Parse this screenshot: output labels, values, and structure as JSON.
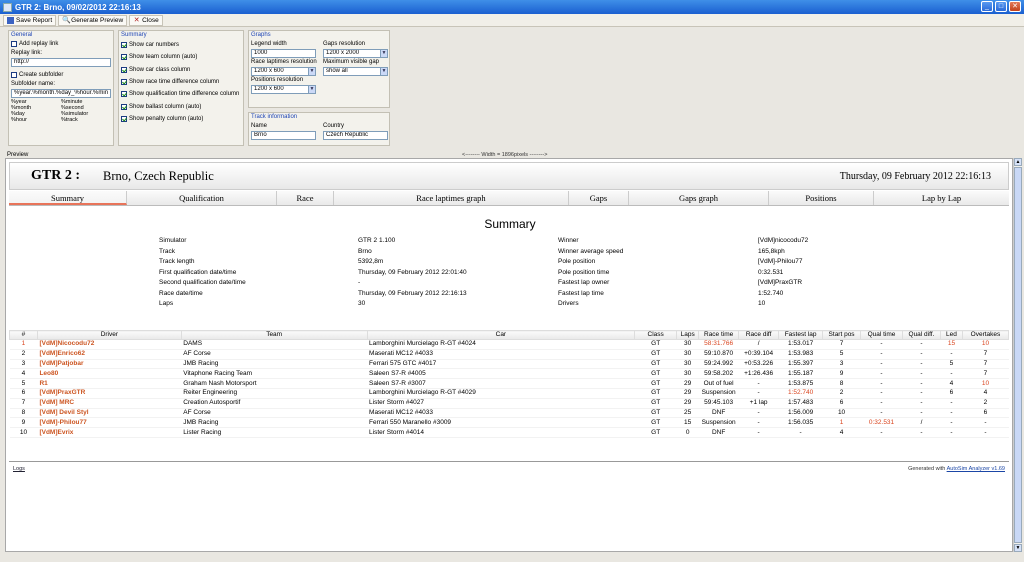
{
  "window": {
    "title": "GTR 2: Brno, 09/02/2012 22:16:13"
  },
  "toolbar": {
    "save_report": "Save Report",
    "generate_preview": "Generate Preview",
    "close": "Close"
  },
  "general": {
    "title": "General",
    "add_replay_link": "Add replay link",
    "replay_link_label": "Replay link:",
    "replay_link_value": "http://",
    "create_subfolder": "Create subfolder",
    "subfolder_name_label": "Subfolder name:",
    "subfolder_name_value": "%year.%month.%day_%hour.%min",
    "vars": [
      "%year",
      "%minute",
      "%month",
      "%second",
      "%day",
      "%simulator",
      "%hour",
      "%track"
    ]
  },
  "summary_opts": {
    "title": "Summary",
    "items": [
      "Show car numbers",
      "Show team column (auto)",
      "Show car class column",
      "Show race time difference column",
      "Show qualification time difference column",
      "Show ballast column (auto)",
      "Show penalty column (auto)"
    ]
  },
  "graphs": {
    "title": "Graphs",
    "legend_width_label": "Legend width",
    "legend_width_value": "1000",
    "gaps_res_label": "Gaps resolution",
    "gaps_res_value": "1200 x 2000",
    "race_lap_res_label": "Race laptimes resolution",
    "race_lap_res_value": "1200 x 600",
    "max_gap_label": "Maximum visible gap",
    "max_gap_value": "show all",
    "positions_res_label": "Positions resolution",
    "positions_res_value": "1200 x 600"
  },
  "track_info": {
    "title": "Track information",
    "name_label": "Name",
    "name_value": "Brno",
    "country_label": "Country",
    "country_value": "Czech Republic"
  },
  "preview_label": "Preview",
  "width_note": "<-------- Width = 1896pixels -------->",
  "report": {
    "header": {
      "sim": "GTR 2 :",
      "track": "Brno, Czech Republic",
      "datetime": "Thursday, 09 February 2012 22:16:13"
    },
    "tabs": [
      "Summary",
      "Qualification",
      "Race",
      "Race laptimes graph",
      "Gaps",
      "Gaps graph",
      "Positions",
      "Lap by Lap"
    ],
    "section_title": "Summary",
    "info_left": [
      [
        "Simulator",
        "GTR 2 1.100"
      ],
      [
        "Track",
        "Brno"
      ],
      [
        "Track length",
        "5392,8m"
      ],
      [
        "First qualification date/time",
        "Thursday, 09 February 2012 22:01:40"
      ],
      [
        "Second qualification date/time",
        "-"
      ],
      [
        "Race date/time",
        "Thursday, 09 February 2012 22:16:13"
      ],
      [
        "Laps",
        "30"
      ]
    ],
    "info_right": [
      [
        "Winner",
        "[VdM]nicocodu72"
      ],
      [
        "Winner average speed",
        "165,8kph"
      ],
      [
        "Pole position",
        "[VdM]-Philou77"
      ],
      [
        "Pole position time",
        "0:32.531"
      ],
      [
        "Fastest lap owner",
        "[VdM]PraxGTR"
      ],
      [
        "Fastest lap time",
        "1:52.740"
      ],
      [
        "Drivers",
        "10"
      ]
    ],
    "columns": [
      "#",
      "Driver",
      "Team",
      "Car",
      "Class",
      "Laps",
      "Race time",
      "Race diff",
      "Fastest lap",
      "Start pos",
      "Qual time",
      "Qual diff.",
      "Led",
      "Overtakes"
    ],
    "rows": [
      [
        "1",
        "[VdM]Nicocodu72",
        "DAMS",
        "Lamborghini Murcielago R-GT #4024",
        "GT",
        "30",
        "58:31.766",
        "/",
        "1:53.017",
        "7",
        "-",
        "-",
        "15",
        "10"
      ],
      [
        "2",
        "[VdM]Enrico62",
        "AF Corse",
        "Maserati MC12 #4033",
        "GT",
        "30",
        "59:10.870",
        "+0:39.104",
        "1:53.983",
        "5",
        "-",
        "-",
        "-",
        "7"
      ],
      [
        "3",
        "[VdM]Patjobar",
        "JMB Racing",
        "Ferrari 575 GTC #4017",
        "GT",
        "30",
        "59:24.992",
        "+0:53.226",
        "1:55.397",
        "3",
        "-",
        "-",
        "5",
        "7"
      ],
      [
        "4",
        "Leo80",
        "Vitaphone Racing Team",
        "Saleen S7-R #4005",
        "GT",
        "30",
        "59:58.202",
        "+1:26.436",
        "1:55.187",
        "9",
        "-",
        "-",
        "-",
        "7"
      ],
      [
        "5",
        "R1",
        "Graham Nash Motorsport",
        "Saleen S7-R #3007",
        "GT",
        "29",
        "Out of fuel",
        "-",
        "1:53.875",
        "8",
        "-",
        "-",
        "4",
        "10"
      ],
      [
        "6",
        "[VdM]PraxGTR",
        "Reiter Engineering",
        "Lamborghini Murcielago R-GT #4029",
        "GT",
        "29",
        "Suspension",
        "-",
        "1:52.740",
        "2",
        "-",
        "-",
        "6",
        "4"
      ],
      [
        "7",
        "[VdM] MRC",
        "Creation Autosportif",
        "Lister Storm #4027",
        "GT",
        "29",
        "59:45.103",
        "+1 lap",
        "1:57.483",
        "6",
        "-",
        "-",
        "-",
        "2"
      ],
      [
        "8",
        "[VdM] Devil Styl",
        "AF Corse",
        "Maserati MC12 #4033",
        "GT",
        "25",
        "DNF",
        "-",
        "1:56.009",
        "10",
        "-",
        "-",
        "-",
        "6"
      ],
      [
        "9",
        "[VdM]-Philou77",
        "JMB Racing",
        "Ferrari 550 Maranello #3009",
        "GT",
        "15",
        "Suspension",
        "-",
        "1:56.035",
        "1",
        "0:32.531",
        "/",
        "-",
        "-"
      ],
      [
        "10",
        "[VdM]Evrix",
        "Lister Racing",
        "Lister Storm #4014",
        "GT",
        "0",
        "DNF",
        "-",
        "-",
        "4",
        "-",
        "-",
        "-",
        "-"
      ]
    ],
    "logs": "Logs",
    "generated_prefix": "Generated with ",
    "generated_link": "AutoSim Analyzer v1.69"
  }
}
